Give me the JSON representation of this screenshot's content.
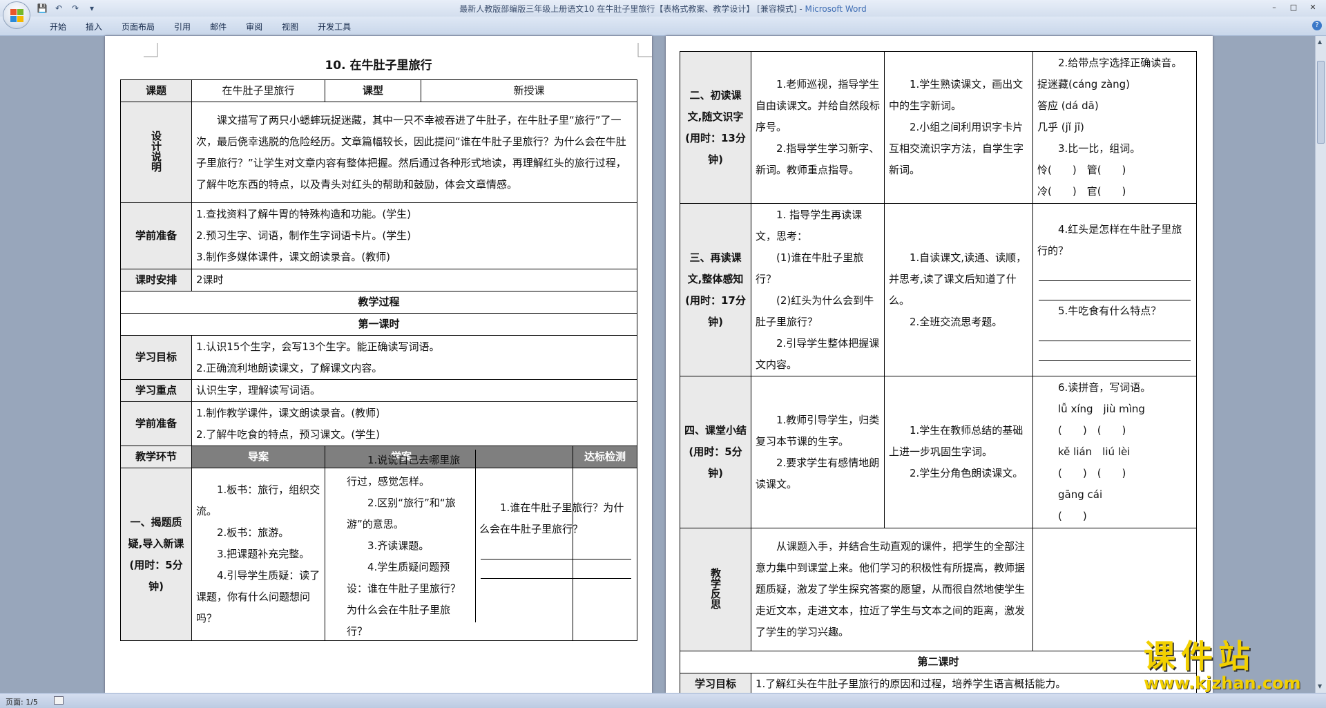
{
  "window": {
    "title": "最新人教版部编版三年级上册语文10 在牛肚子里旅行【表格式教案、教学设计】 [兼容模式]",
    "app_name": "Microsoft Word"
  },
  "ribbon": {
    "tabs": [
      "开始",
      "插入",
      "页面布局",
      "引用",
      "邮件",
      "审阅",
      "视图",
      "开发工具"
    ]
  },
  "status": {
    "page": "页面: 1/5"
  },
  "doc": {
    "title": "10. 在牛肚子里旅行",
    "header": {
      "k1": "课题",
      "v1": "在牛肚子里旅行",
      "k2": "课型",
      "v2": "新授课"
    },
    "design": {
      "label": "设计说明",
      "text": "课文描写了两只小蟋蟀玩捉迷藏，其中一只不幸被吞进了牛肚子，在牛肚子里“旅行”了一次，最后侥幸逃脱的危险经历。文章篇幅较长，因此提问“谁在牛肚子里旅行？为什么会在牛肚子里旅行？”让学生对文章内容有整体把握。然后通过各种形式地读，再理解红头的旅行过程，了解牛吃东西的特点，以及青头对红头的帮助和鼓励，体会文章情感。"
    },
    "prep1": {
      "label": "学前准备",
      "items": [
        "1.查找资料了解牛胃的特殊构造和功能。(学生)",
        "2.预习生字、词语，制作生字词语卡片。(学生)",
        "3.制作多媒体课件，课文朗读录音。(教师)"
      ]
    },
    "hours": {
      "label": "课时安排",
      "value": "2课时"
    },
    "process": "教学过程",
    "lesson1": "第一课时",
    "goals": {
      "label": "学习目标",
      "items": [
        "1.认识15个生字，会写13个生字。能正确读写词语。",
        "2.正确流利地朗读课文，了解课文内容。"
      ]
    },
    "focus": {
      "label": "学习重点",
      "value": "认识生字，理解读写词语。"
    },
    "prep2": {
      "label": "学前准备",
      "items": [
        "1.制作教学课件，课文朗读录音。(教师)",
        "2.了解牛吃食的特点，预习课文。(学生)"
      ]
    },
    "cols": {
      "stage": "教学环节",
      "guide": "导案",
      "learn": "学案",
      "check": "达标检测"
    },
    "s1": {
      "stage": "一、揭题质疑,导入新课(用时：5分钟)",
      "guide": [
        "1.板书：旅行，组织交流。",
        "2.板书：旅游。",
        "3.把课题补充完整。",
        "4.引导学生质疑：读了课题，你有什么问题想问吗？"
      ],
      "learn": [
        "1.说说自己去哪里旅行过，感觉怎样。",
        "2.区别“旅行”和“旅游”的意思。",
        "3.齐读课题。",
        "4.学生质疑问题预设：谁在牛肚子里旅行？为什么会在牛肚子里旅行？"
      ],
      "check": "1.谁在牛肚子里旅行？为什么会在牛肚子里旅行？"
    },
    "s2": {
      "stage": "二、初读课文,随文识字(用时：13分钟)",
      "guide": [
        "1.老师巡视，指导学生自由读课文。并给自然段标序号。",
        "2.指导学生学习新字、新词。教师重点指导。"
      ],
      "learn": [
        "1.学生熟读课文，画出文中的生字新词。",
        "2.小组之间利用识字卡片互相交流识字方法，自学生字新词。"
      ],
      "check": [
        "2.给带点字选择正确读音。",
        "捉迷藏(cáng zàng)",
        "答应 (dá dā)",
        "几乎 (jǐ jī)",
        "3.比一比，组词。",
        "怜(　　)　管(　　)",
        "冷(　　)　官(　　)"
      ]
    },
    "s3": {
      "stage": "三、再读课文,整体感知(用时：17分钟)",
      "guide": [
        "1. 指导学生再读课文，思考：",
        "(1)谁在牛肚子里旅行？",
        "(2)红头为什么会到牛肚子里旅行？",
        "2.引导学生整体把握课文内容。"
      ],
      "learn": [
        "1.自读课文,读通、读顺，并思考,读了课文后知道了什么。",
        "2.全班交流思考题。"
      ],
      "check": [
        "4.红头是怎样在牛肚子里旅行的？",
        "5.牛吃食有什么特点？"
      ]
    },
    "s4": {
      "stage": "四、课堂小结(用时：5分钟)",
      "guide": [
        "1.教师引导学生，归类复习本节课的生字。",
        "2.要求学生有感情地朗读课文。"
      ],
      "learn": [
        "1.学生在教师总结的基础上进一步巩固生字词。",
        "2.学生分角色朗读课文。"
      ],
      "check": [
        "6.读拼音，写词语。",
        "lǚ xíng　jiù mìng",
        "(　　)　(　　)",
        "kě lián　liú lèi",
        "(　　)　(　　)",
        "gāng cái",
        "(　　)"
      ]
    },
    "reflect": {
      "label": "教学反思",
      "text": "从课题入手，并结合生动直观的课件，把学生的全部注意力集中到课堂上来。他们学习的积极性有所提高，教师据题质疑，激发了学生探究答案的愿望，从而很自然地使学生走近文本，走进文本，拉近了学生与文本之间的距离，激发了学生的学习兴趣。"
    },
    "lesson2": "第二课时",
    "goals2": {
      "label": "学习目标",
      "value": "1.了解红头在牛肚子里旅行的原因和过程，培养学生语言概括能力。"
    }
  },
  "watermark": {
    "name": "课件站",
    "url": "www.kjzhan.com"
  }
}
